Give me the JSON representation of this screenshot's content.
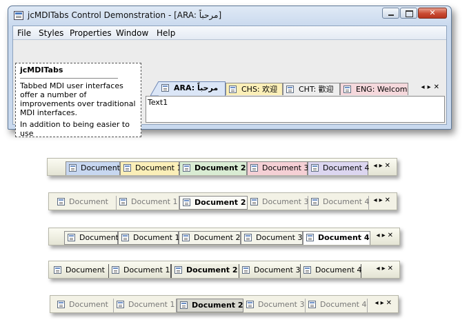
{
  "window": {
    "title": "jcMDITabs Control Demonstration - [ARA: مرحباً]",
    "controls": {
      "minimize": "minimize",
      "maximize": "maximize",
      "close": "✕"
    }
  },
  "menu": [
    "File",
    "Styles",
    "Properties",
    "Window",
    "Help"
  ],
  "info_panel": {
    "title": "jcMDITabs",
    "paragraphs": [
      "Tabbed MDI user interfaces offer a number of improvements over traditional MDI interfaces.",
      "In addition to being easier to use"
    ]
  },
  "mdi_tabs": [
    {
      "label": "ARA: مرحباً",
      "color": "#dbe6f7",
      "active": true
    },
    {
      "label": "CHS: 欢迎",
      "color": "#fbefb8",
      "active": false
    },
    {
      "label": "CHT: 歡迎",
      "color": "#eeeeee",
      "active": false
    },
    {
      "label": "ENG: Welcome",
      "color": "#f5d8dc",
      "active": false
    }
  ],
  "strip_controls": {
    "left": "◂",
    "right": "▸",
    "close": "✕"
  },
  "document_text": "Text1",
  "samples": [
    {
      "style": "colored",
      "tabs": [
        "Document",
        "Document 1",
        "Document 2",
        "Document 3",
        "Document 4"
      ],
      "active": 2,
      "colors": [
        "#c7d7f0",
        "#fbefb8",
        "#d9ecd3",
        "#f5d0d5",
        "#dcd6f0"
      ]
    },
    {
      "style": "flat-faint",
      "tabs": [
        "Document",
        "Document 1",
        "Document 2",
        "Document 3",
        "Document 4"
      ],
      "active": 2
    },
    {
      "style": "angled",
      "tabs": [
        "Document",
        "Document 1",
        "Document 2",
        "Document 3",
        "Document 4"
      ],
      "active": 4
    },
    {
      "style": "button",
      "tabs": [
        "Document",
        "Document 1",
        "Document 2",
        "Document 3",
        "Document 4"
      ],
      "active": 2
    },
    {
      "style": "flat-gray",
      "tabs": [
        "Document",
        "Document 1",
        "Document 2",
        "Document 3",
        "Document 4"
      ],
      "active": 2
    }
  ]
}
